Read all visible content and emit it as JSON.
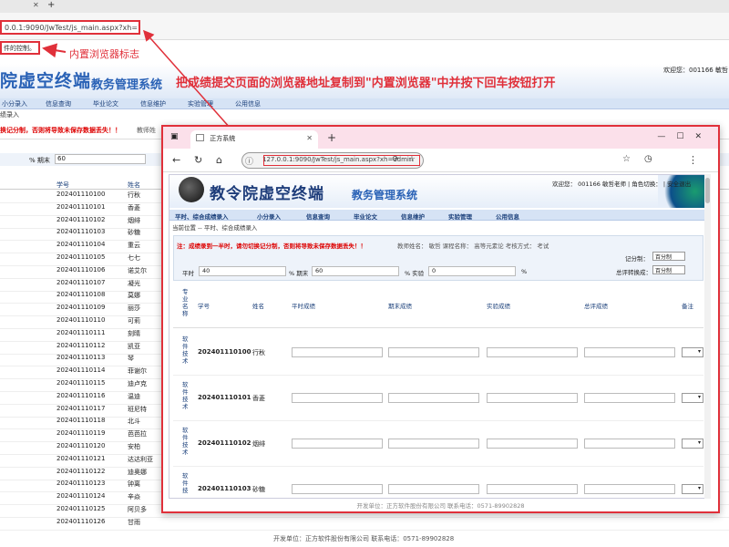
{
  "background": {
    "url": "0.0.1:9090/JwTest/js_main.aspx?xh=1",
    "status_box": "件的控制。",
    "annotation_label": "内置浏览器标志",
    "logo": "院虚空终端",
    "system_name": "教务管理系统",
    "welcome": "欢迎您：001166 敏哲",
    "instruction": "把成绩提交页面的浏览器地址复制到\"内置浏览器\"中并按下回车按钮打开",
    "menu": [
      "小分录入",
      "信息查询",
      "毕业论文",
      "信息维护",
      "实验管理",
      "公用信息"
    ],
    "crumb": "绩录入",
    "warning": "换记分制，否则将导致未保存数据丢失！！",
    "warning2": "教师姓",
    "score_label": "% 期末",
    "score_value": "60",
    "col_id": "学号",
    "col_name": "姓名",
    "rows": [
      {
        "id": "202401110100",
        "name": "行秋"
      },
      {
        "id": "202401110101",
        "name": "香菱"
      },
      {
        "id": "202401110102",
        "name": "烟绯"
      },
      {
        "id": "202401110103",
        "name": "砂糖"
      },
      {
        "id": "202401110104",
        "name": "重云"
      },
      {
        "id": "202401110105",
        "name": "七七"
      },
      {
        "id": "202401110106",
        "name": "诺艾尔"
      },
      {
        "id": "202401110107",
        "name": "凝光"
      },
      {
        "id": "202401110108",
        "name": "莫娜"
      },
      {
        "id": "202401110109",
        "name": "丽莎"
      },
      {
        "id": "202401110110",
        "name": "可莉"
      },
      {
        "id": "202401110111",
        "name": "刻晴"
      },
      {
        "id": "202401110112",
        "name": "凯亚"
      },
      {
        "id": "202401110113",
        "name": "琴"
      },
      {
        "id": "202401110114",
        "name": "菲谢尔"
      },
      {
        "id": "202401110115",
        "name": "迪卢克"
      },
      {
        "id": "202401110116",
        "name": "温迪"
      },
      {
        "id": "202401110117",
        "name": "班尼特"
      },
      {
        "id": "202401110118",
        "name": "北斗"
      },
      {
        "id": "202401110119",
        "name": "芭芭拉"
      },
      {
        "id": "202401110120",
        "name": "安柏"
      },
      {
        "id": "202401110121",
        "name": "达达利亚"
      },
      {
        "id": "202401110122",
        "name": "迪奥娜"
      },
      {
        "id": "202401110123",
        "name": "钟离"
      },
      {
        "id": "202401110124",
        "name": "辛焱"
      },
      {
        "id": "202401110125",
        "name": "阿贝多"
      },
      {
        "id": "202401110126",
        "name": "甘雨"
      }
    ],
    "footer": "开发单位：正方软件股份有限公司 联系电话：0571-89902828"
  },
  "window": {
    "tab_title": "正方系统",
    "url": "127.0.0.1:9090/JwTest/js_main.aspx?xh=admin",
    "logo": "教令院虚空终端",
    "system_name": "教务管理系统",
    "welcome": "欢迎您：  001166 敏哲老师 | 角色切换：  |  安全退出",
    "menu": [
      "平时、综合成绩录入",
      "小分录入",
      "信息查询",
      "毕业论文",
      "信息维护",
      "实验管理",
      "公用信息"
    ],
    "crumb": "当前位置 -- 平时、综合成绩录入",
    "warning": "注：成绩录到一半时，请勿切换记分制，否则将导致未保存数据丢失！！",
    "teacher_info": "教师姓名：  敏哲    课程名称：  高等元素论    考核方式：  考试",
    "grading_label": "记分制：",
    "grading_value": "百分制",
    "total_label": "总评转换成：",
    "total_value": "百分制",
    "score_fields": [
      {
        "label": "平时",
        "value": "40"
      },
      {
        "label": "% 期末",
        "value": "60"
      },
      {
        "label": "% 实验",
        "value": "0"
      },
      {
        "label": "%",
        "value": ""
      }
    ],
    "headers": {
      "major": "专业名称",
      "id": "学号",
      "name": "姓名",
      "regular": "平时成绩",
      "final": "期末成绩",
      "lab": "实验成绩",
      "total": "总评成绩",
      "remark": "备注"
    },
    "rows": [
      {
        "major": "软件技术",
        "id": "202401110100",
        "name": "行秋"
      },
      {
        "major": "软件技术",
        "id": "202401110101",
        "name": "香菱"
      },
      {
        "major": "软件技术",
        "id": "202401110102",
        "name": "烟绯"
      },
      {
        "major": "软件技",
        "id": "202401110103",
        "name": "砂糖"
      }
    ],
    "footer": "开发单位：正方软件股份有限公司 联系电话：0571-89902828"
  },
  "colors": {
    "accent_red": "#e0303a",
    "brand_blue": "#2a62b6"
  }
}
